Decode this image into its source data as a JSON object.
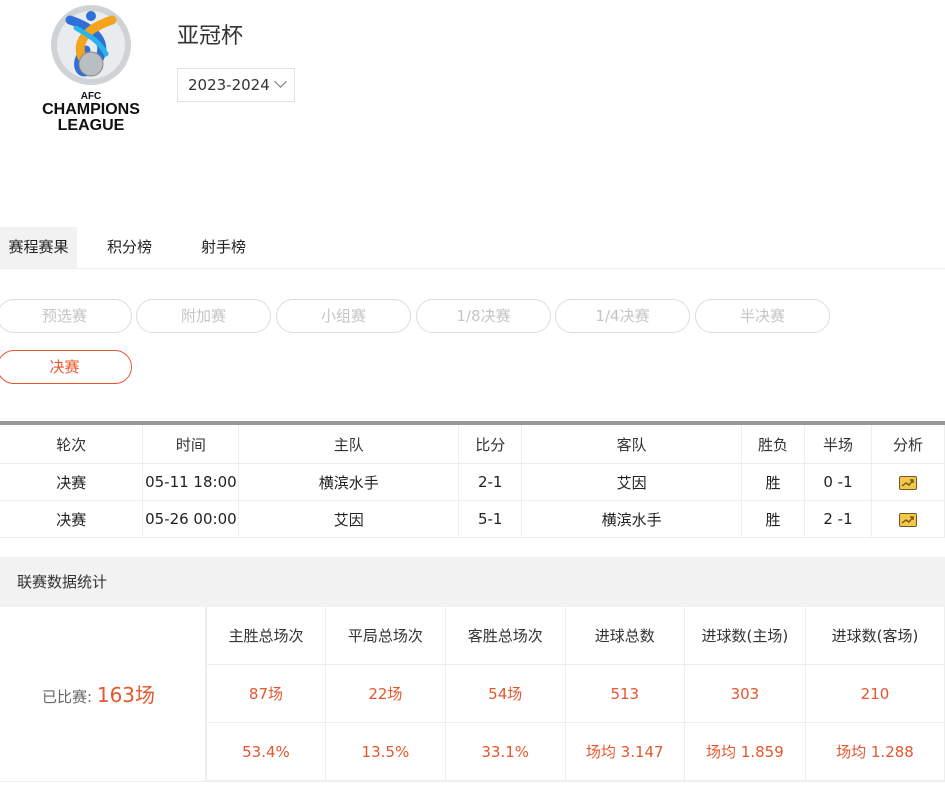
{
  "header": {
    "logo_text": [
      "AFC",
      "CHAMPIONS",
      "LEAGUE"
    ],
    "title": "亚冠杯",
    "season": "2023-2024"
  },
  "tabs": [
    "赛程赛果",
    "积分榜",
    "射手榜"
  ],
  "stages": [
    "预选赛",
    "附加赛",
    "小组赛",
    "1/8决赛",
    "1/4决赛",
    "半决赛",
    "决赛"
  ],
  "active_stage": "决赛",
  "fixtures": {
    "headers": [
      "轮次",
      "时间",
      "主队",
      "比分",
      "客队",
      "胜负",
      "半场",
      "分析"
    ],
    "rows": [
      {
        "round": "决赛",
        "time": "05-11 18:00",
        "home": "横滨水手",
        "score": "2-1",
        "away": "艾因",
        "result": "胜",
        "half": "0 -1"
      },
      {
        "round": "决赛",
        "time": "05-26 00:00",
        "home": "艾因",
        "score": "5-1",
        "away": "横滨水手",
        "result": "胜",
        "half": "2 -1"
      }
    ]
  },
  "stats": {
    "title": "联赛数据统计",
    "played_label": "已比赛:",
    "played_value": "163场",
    "columns": [
      "主胜总场次",
      "平局总场次",
      "客胜总场次",
      "进球总数",
      "进球数(主场)",
      "进球数(客场)"
    ],
    "counts": [
      "87场",
      "22场",
      "54场",
      "513",
      "303",
      "210"
    ],
    "ratios": [
      "53.4%",
      "13.5%",
      "33.1%",
      "场均 3.147",
      "场均 1.859",
      "场均 1.288"
    ]
  },
  "colors": {
    "accent": "#e5572c",
    "header_bg": "#f2f2f2"
  },
  "icons": {
    "analysis": "chart-trend-icon"
  }
}
